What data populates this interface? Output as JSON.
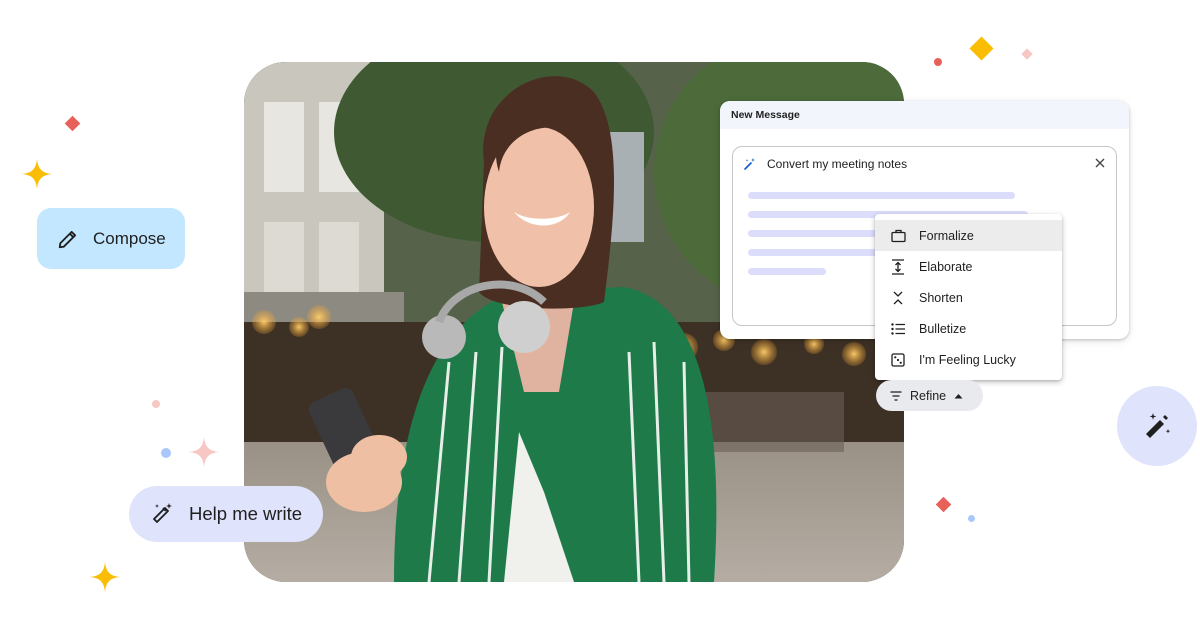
{
  "compose": {
    "label": "Compose",
    "icon": "pencil-icon"
  },
  "help_me_write": {
    "label": "Help me write",
    "icon": "magic-pen-icon"
  },
  "magic_button": {
    "icon": "magic-pen-icon"
  },
  "new_message": {
    "title": "New Message",
    "prompt": "Convert my meeting notes",
    "prompt_icon": "magic-wand-icon",
    "close_icon": "close-icon"
  },
  "refine_menu": {
    "items": [
      {
        "label": "Formalize",
        "icon": "briefcase-icon"
      },
      {
        "label": "Elaborate",
        "icon": "expand-vertical-icon"
      },
      {
        "label": "Shorten",
        "icon": "collapse-vertical-icon"
      },
      {
        "label": "Bulletize",
        "icon": "bulleted-list-icon"
      },
      {
        "label": "I'm Feeling Lucky",
        "icon": "dice-icon"
      }
    ]
  },
  "refine_button": {
    "label": "Refine",
    "icon": "filter-icon",
    "caret_icon": "caret-up-icon"
  },
  "colors": {
    "compose_bg": "#c2e7ff",
    "help_bg": "#dfe3fb",
    "placeholder_line": "#dcdcfb",
    "sparkle_yellow": "#fbbc04",
    "sparkle_red": "#ea4335",
    "sparkle_pink": "#f6c7c3",
    "dot_blue": "#a8c7fa"
  }
}
